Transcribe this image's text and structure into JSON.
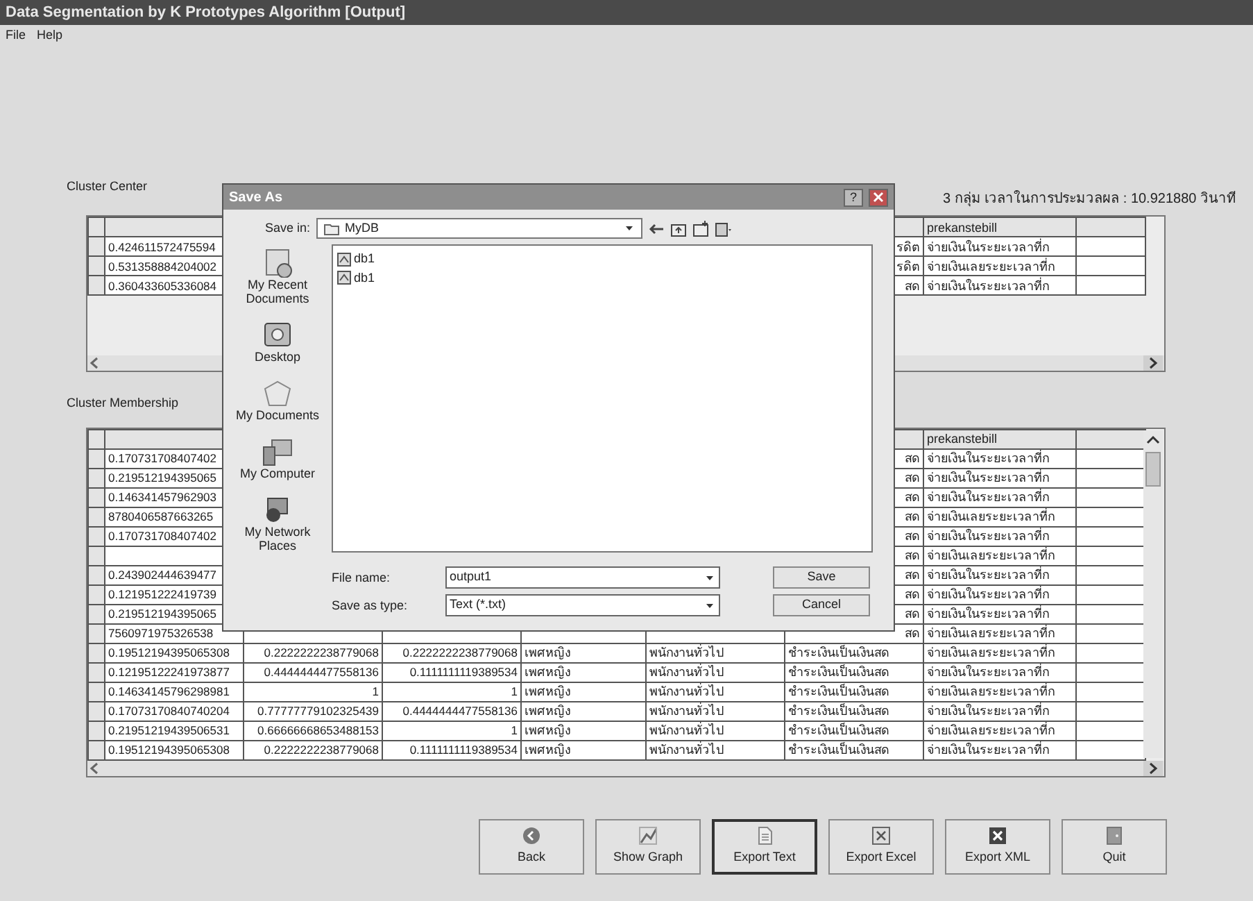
{
  "window": {
    "title": "Data Segmentation by K Prototypes Algorithm [Output]"
  },
  "menu": [
    "File",
    "Help"
  ],
  "summary": "3 กลุ่ม  เวลาในการประมวลผล : 10.921880 วินาที",
  "cluster_center": {
    "label": "Cluster Center",
    "columns": [
      "",
      "",
      "",
      "",
      "",
      "",
      "prekanstebill",
      ""
    ],
    "rows": [
      {
        "kind": "partial",
        "cells": [
          "0.424611572475594",
          "",
          "",
          "",
          "",
          "รดิต",
          "จ่ายเงินในระยะเวลาที่ก",
          ""
        ]
      },
      {
        "kind": "partial",
        "cells": [
          "0.531358884204002",
          "",
          "",
          "",
          "",
          "รดิต",
          "จ่ายเงินเลยระยะเวลาที่ก",
          ""
        ]
      },
      {
        "kind": "partial",
        "cells": [
          "0.360433605336084",
          "",
          "",
          "",
          "",
          "สด",
          "จ่ายเงินในระยะเวลาที่ก",
          ""
        ]
      }
    ]
  },
  "cluster_membership": {
    "label": "Cluster Membership",
    "columns": [
      "",
      "",
      "",
      "",
      "",
      "",
      "prekanstebill",
      ""
    ],
    "rows": [
      {
        "kind": "partial",
        "cells": [
          "0.170731708407402",
          "",
          "",
          "",
          "",
          "สด",
          "จ่ายเงินในระยะเวลาที่ก",
          ""
        ]
      },
      {
        "kind": "partial",
        "cells": [
          "0.219512194395065",
          "",
          "",
          "",
          "",
          "สด",
          "จ่ายเงินในระยะเวลาที่ก",
          ""
        ]
      },
      {
        "kind": "partial",
        "cells": [
          "0.146341457962903",
          "",
          "",
          "",
          "",
          "สด",
          "จ่ายเงินในระยะเวลาที่ก",
          ""
        ]
      },
      {
        "kind": "partial",
        "cells": [
          "8780406587663265",
          "",
          "",
          "",
          "",
          "สด",
          "จ่ายเงินเลยระยะเวลาที่ก",
          ""
        ]
      },
      {
        "kind": "partial",
        "cells": [
          "0.170731708407402",
          "",
          "",
          "",
          "",
          "สด",
          "จ่ายเงินในระยะเวลาที่ก",
          ""
        ]
      },
      {
        "kind": "partial",
        "cells": [
          "",
          "",
          "",
          "",
          "",
          "สด",
          "จ่ายเงินเลยระยะเวลาที่ก",
          ""
        ]
      },
      {
        "kind": "partial",
        "cells": [
          "0.243902444639477",
          "",
          "",
          "",
          "",
          "สด",
          "จ่ายเงินในระยะเวลาที่ก",
          ""
        ]
      },
      {
        "kind": "partial",
        "cells": [
          "0.121951222419739",
          "",
          "",
          "",
          "",
          "สด",
          "จ่ายเงินในระยะเวลาที่ก",
          ""
        ]
      },
      {
        "kind": "partial",
        "cells": [
          "0.219512194395065",
          "",
          "",
          "",
          "",
          "สด",
          "จ่ายเงินในระยะเวลาที่ก",
          ""
        ]
      },
      {
        "kind": "partial",
        "cells": [
          "7560971975326538",
          "",
          "",
          "",
          "",
          "สด",
          "จ่ายเงินเลยระยะเวลาที่ก",
          ""
        ]
      },
      {
        "kind": "full",
        "cells": [
          "0.19512194395065308",
          "0.2222222238779068",
          "0.2222222238779068",
          "เพศหญิง",
          "พนักงานทั่วไป",
          "ชำระเงินเป็นเงินสด",
          "จ่ายเงินเลยระยะเวลาที่ก",
          ""
        ]
      },
      {
        "kind": "full",
        "cells": [
          "0.12195122241973877",
          "0.4444444477558136",
          "0.1111111119389534",
          "เพศหญิง",
          "พนักงานทั่วไป",
          "ชำระเงินเป็นเงินสด",
          "จ่ายเงินในระยะเวลาที่ก",
          ""
        ]
      },
      {
        "kind": "full",
        "cells": [
          "0.14634145796298981",
          "1",
          "1",
          "เพศหญิง",
          "พนักงานทั่วไป",
          "ชำระเงินเป็นเงินสด",
          "จ่ายเงินเลยระยะเวลาที่ก",
          ""
        ]
      },
      {
        "kind": "full",
        "cells": [
          "0.17073170840740204",
          "0.77777779102325439",
          "0.4444444477558136",
          "เพศหญิง",
          "พนักงานทั่วไป",
          "ชำระเงินเป็นเงินสด",
          "จ่ายเงินในระยะเวลาที่ก",
          ""
        ]
      },
      {
        "kind": "full",
        "cells": [
          "0.21951219439506531",
          "0.66666668653488153",
          "1",
          "เพศหญิง",
          "พนักงานทั่วไป",
          "ชำระเงินเป็นเงินสด",
          "จ่ายเงินเลยระยะเวลาที่ก",
          ""
        ]
      },
      {
        "kind": "full",
        "cells": [
          "0.19512194395065308",
          "0.2222222238779068",
          "0.1111111119389534",
          "เพศหญิง",
          "พนักงานทั่วไป",
          "ชำระเงินเป็นเงินสด",
          "จ่ายเงินในระยะเวลาที่ก",
          ""
        ]
      }
    ]
  },
  "buttons": [
    {
      "label": "Back",
      "kind": "back",
      "focused": false
    },
    {
      "label": "Show Graph",
      "kind": "graph",
      "focused": false
    },
    {
      "label": "Export Text",
      "kind": "text",
      "focused": true
    },
    {
      "label": "Export Excel",
      "kind": "excel",
      "focused": false
    },
    {
      "label": "Export XML",
      "kind": "xml",
      "focused": false
    },
    {
      "label": "Quit",
      "kind": "quit",
      "focused": false
    }
  ],
  "dialog": {
    "title": "Save As",
    "help": "?",
    "save_in_label": "Save in:",
    "save_in": "MyDB",
    "places": [
      {
        "label": "My Recent Documents",
        "kind": "recent"
      },
      {
        "label": "Desktop",
        "kind": "desktop"
      },
      {
        "label": "My Documents",
        "kind": "documents"
      },
      {
        "label": "My Computer",
        "kind": "computer"
      },
      {
        "label": "My Network Places",
        "kind": "network"
      }
    ],
    "files": [
      "db1",
      "db1"
    ],
    "file_name_label": "File name:",
    "file_name": "output1",
    "type_label": "Save as type:",
    "type": "Text (*.txt)",
    "buttons": [
      "Save",
      "Cancel"
    ]
  }
}
